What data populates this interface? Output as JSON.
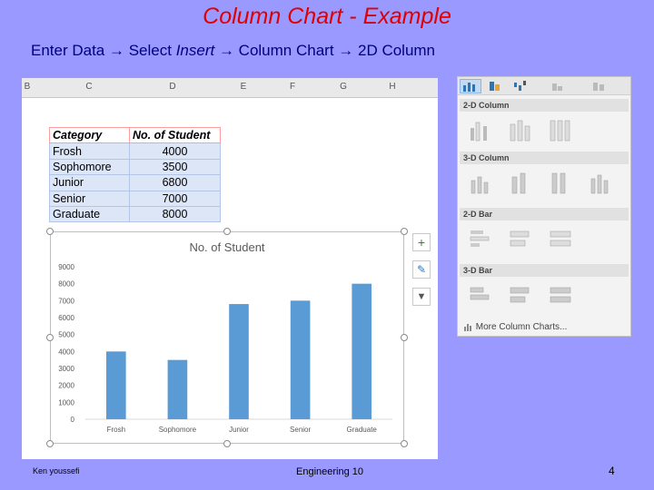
{
  "slide": {
    "title": "Column Chart - Example",
    "subtitle_pre": "Enter Data → Select ",
    "subtitle_insert": "Insert",
    "subtitle_post": " → Column Chart → 2D Column"
  },
  "sheet": {
    "columns": [
      "B",
      "C",
      "D",
      "E",
      "F",
      "G",
      "H"
    ],
    "headers": [
      "Category",
      "No.  of Student"
    ],
    "rows": [
      {
        "category": "Frosh",
        "value": "4000"
      },
      {
        "category": "Sophomore",
        "value": "3500"
      },
      {
        "category": "Junior",
        "value": "6800"
      },
      {
        "category": "Senior",
        "value": "7000"
      },
      {
        "category": "Graduate",
        "value": "8000"
      }
    ]
  },
  "chart_data": {
    "type": "bar",
    "title": "No.  of Student",
    "categories": [
      "Frosh",
      "Sophomore",
      "Junior",
      "Senior",
      "Graduate"
    ],
    "values": [
      4000,
      3500,
      6800,
      7000,
      8000
    ],
    "yticks": [
      "0",
      "1000",
      "2000",
      "3000",
      "4000",
      "5000",
      "6000",
      "7000",
      "8000",
      "9000"
    ],
    "ylim": [
      0,
      9000
    ],
    "color": "#5b9bd5",
    "grid": false
  },
  "side_buttons": {
    "plus": "+",
    "brush": "✎",
    "filter": "▼"
  },
  "gallery": {
    "sections": [
      "2-D Column",
      "3-D Column",
      "2-D Bar",
      "3-D Bar"
    ],
    "more_label": "More Column Charts..."
  },
  "footer": {
    "author": "Ken youssefi",
    "course": "Engineering 10",
    "page": "4"
  }
}
